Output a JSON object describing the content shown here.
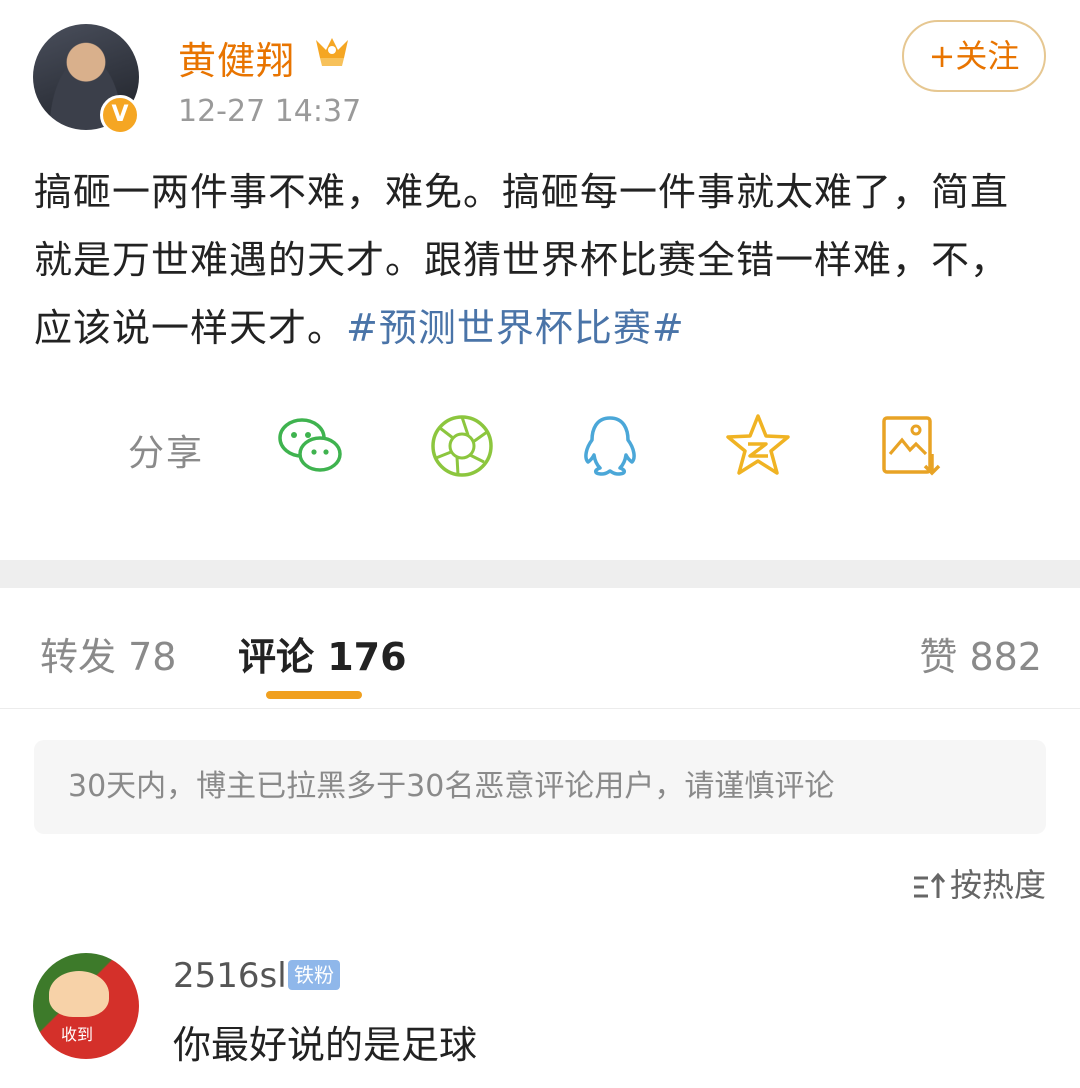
{
  "post": {
    "author": "黄健翔",
    "verified_badge": "V",
    "time": "12-27 14:37",
    "follow_label": "+关注",
    "text": "搞砸一两件事不难，难免。搞砸每一件事就太难了，简直就是万世难遇的天才。跟猜世界杯比赛全错一样难，不，应该说一样天才。",
    "hashtag": "#预测世界杯比赛#"
  },
  "share": {
    "label": "分享",
    "icons": [
      "wechat-icon",
      "moments-icon",
      "qq-icon",
      "qzone-icon",
      "save-image-icon"
    ],
    "colors": {
      "wechat": "#3fb34f",
      "moments": "#8cc63e",
      "qq": "#4ba7d8",
      "qzone": "#f0b323",
      "save": "#e8a325"
    }
  },
  "tabs": {
    "repost": "转发 78",
    "comment": "评论 176",
    "like": "赞 882"
  },
  "notice": "30天内，博主已拉黑多于30名恶意评论用户，请谨慎评论",
  "sort_label": "按热度",
  "comment": {
    "user": "2516sl",
    "badge": "铁粉",
    "avatar_text": "收到",
    "text": "你最好说的是足球"
  },
  "colors": {
    "accent": "#e87400",
    "hashtag": "#4a74a8",
    "tab_underline": "#f0a020"
  }
}
